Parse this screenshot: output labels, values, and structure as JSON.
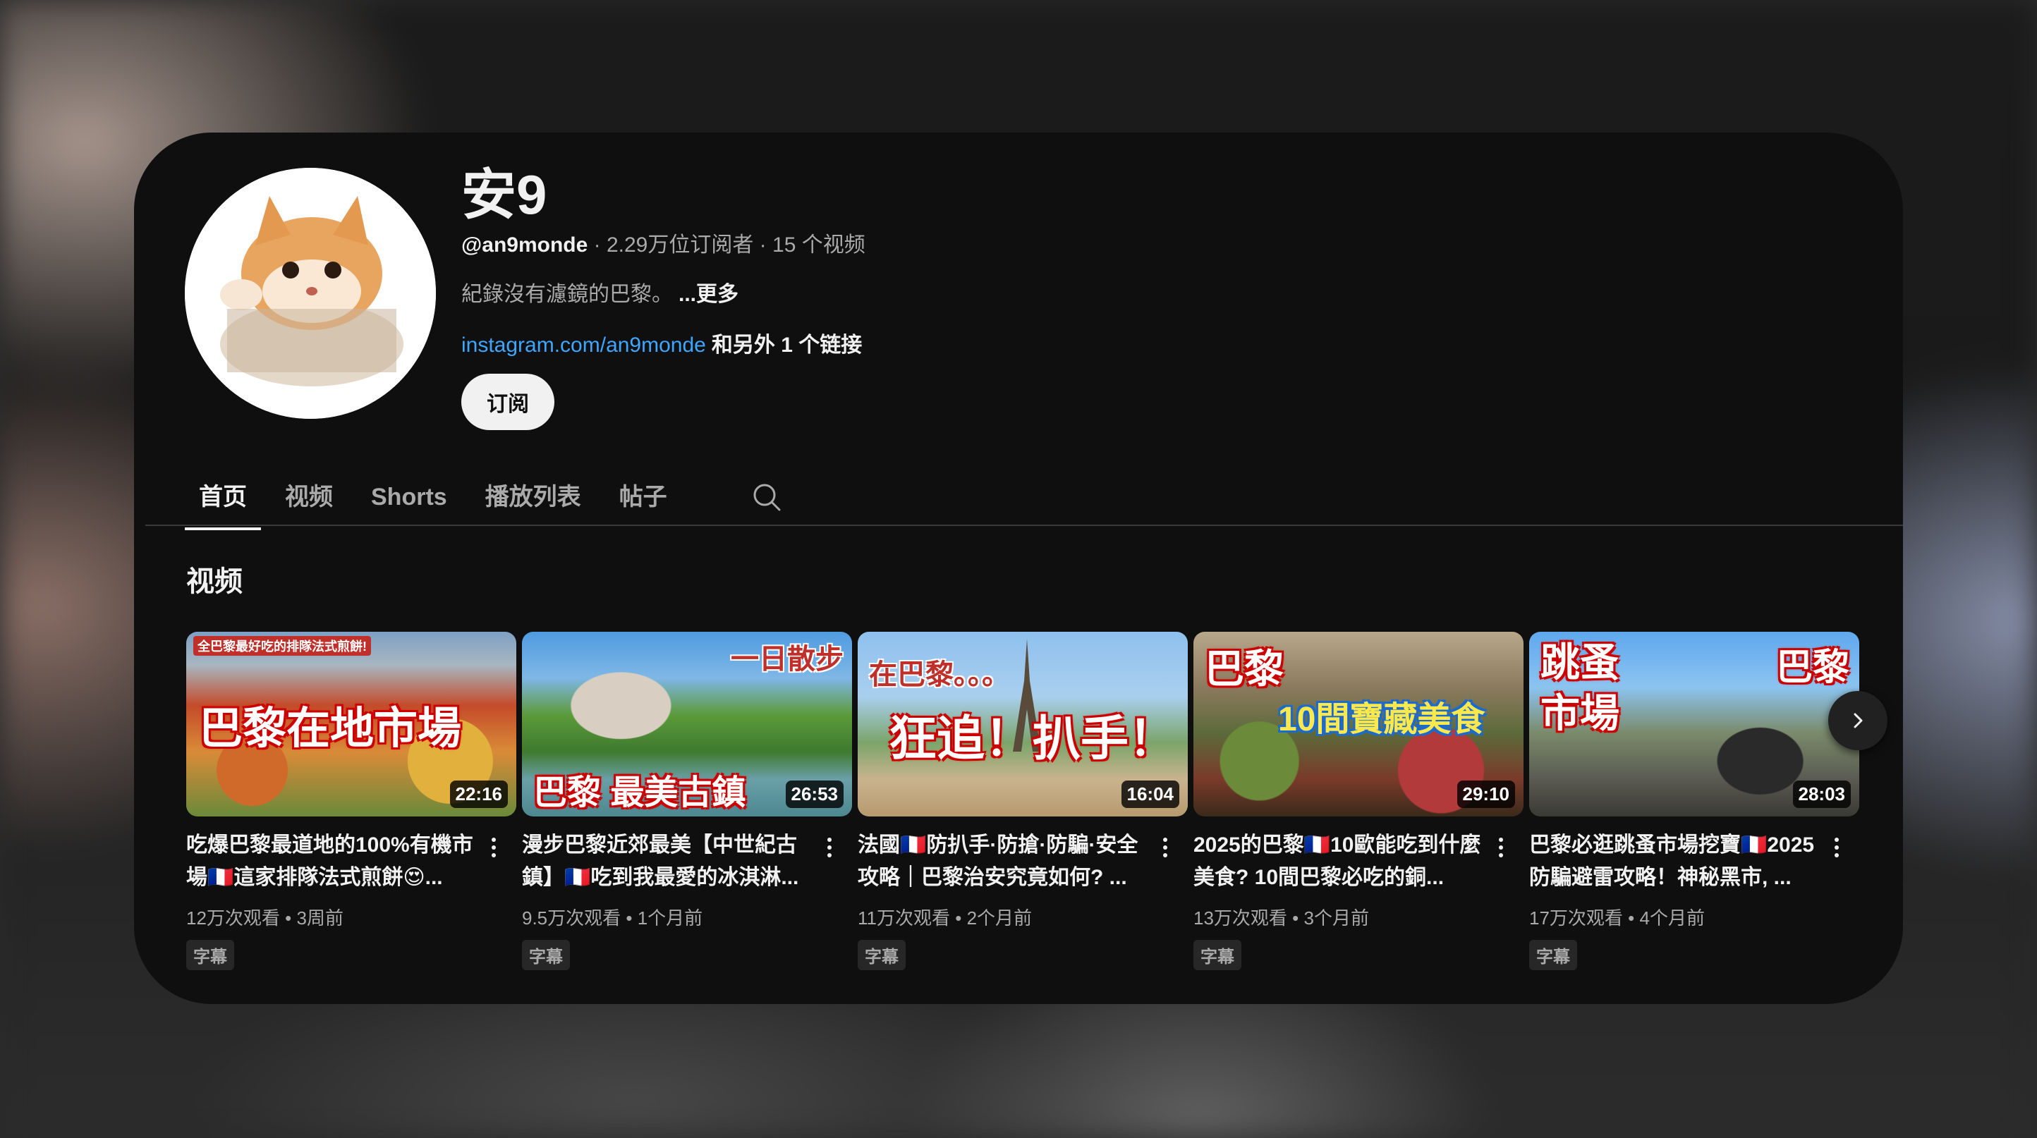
{
  "channel": {
    "name": "安9",
    "handle": "@an9monde",
    "stats": " · 2.29万位订阅者 · 15 个视频",
    "description": "紀錄沒有濾鏡的巴黎。",
    "more": "...更多",
    "link": "instagram.com/an9monde",
    "extra_links": "和另外 1 个链接",
    "subscribe_label": "订阅"
  },
  "tabs": [
    {
      "label": "首页",
      "active": true
    },
    {
      "label": "视频"
    },
    {
      "label": "Shorts"
    },
    {
      "label": "播放列表"
    },
    {
      "label": "帖子"
    }
  ],
  "section_title": "视频",
  "videos": [
    {
      "title": "吃爆巴黎最道地的100%有機市場🇫🇷這家排隊法式煎餅😍...",
      "views": "12万次观看",
      "age": "3周前",
      "duration": "22:16",
      "badge": "字幕",
      "headline": "巴黎在地市場",
      "tagline": "全巴黎最好吃的排隊法式煎餅!"
    },
    {
      "title": "漫步巴黎近郊最美【中世紀古鎮】🇫🇷吃到我最愛的冰淇淋...",
      "views": "9.5万次观看",
      "age": "1个月前",
      "duration": "26:53",
      "badge": "字幕",
      "headline": "巴黎 最美古鎮",
      "tagline": "一日散步"
    },
    {
      "title": "法國🇫🇷防扒手·防搶·防騙·安全攻略｜巴黎治安究竟如何? ...",
      "views": "11万次观看",
      "age": "2个月前",
      "duration": "16:04",
      "badge": "字幕",
      "headline": "狂追！扒手！",
      "tagline": "在巴黎。。。"
    },
    {
      "title": "2025的巴黎🇫🇷10歐能吃到什麼美食? 10間巴黎必吃的銅...",
      "views": "13万次观看",
      "age": "3个月前",
      "duration": "29:10",
      "badge": "字幕",
      "headline": "10間寶藏美食",
      "tagline": "巴黎"
    },
    {
      "title": "巴黎必逛跳蚤市場挖寶🇫🇷2025防騙避雷攻略！神秘黑市, ...",
      "views": "17万次观看",
      "age": "4个月前",
      "duration": "28:03",
      "badge": "字幕",
      "headline": "跳蚤 市場",
      "tagline": "巴黎"
    }
  ],
  "colors": {
    "background": "#0f0f0f",
    "text": "#f1f1f1",
    "secondary_text": "#aaaaaa",
    "link": "#3ea6ff"
  }
}
